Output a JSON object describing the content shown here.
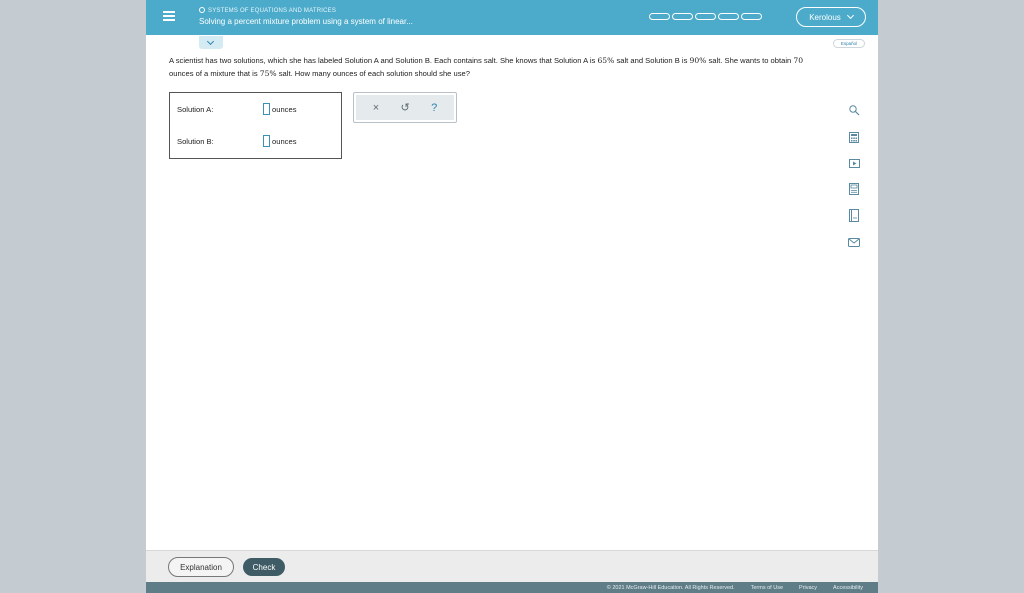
{
  "header": {
    "topic": "SYSTEMS OF EQUATIONS AND MATRICES",
    "lesson_title": "Solving a percent mixture problem using a system of linear...",
    "progress_segments": 5,
    "user_name": "Kerolous"
  },
  "language_toggle": "Español",
  "question": {
    "part1": "A scientist has two solutions, which she has labeled Solution A and Solution B. Each contains salt. She knows that Solution A is ",
    "pct_a": "65%",
    "part2": " salt and Solution B is ",
    "pct_b": "90%",
    "part3": " salt. She wants to obtain ",
    "ounces": "70",
    "part4": " ounces of a mixture that is ",
    "pct_mix": "75%",
    "part5": " salt. How many ounces of each solution should she use?"
  },
  "answers": [
    {
      "label": "Solution A:",
      "unit": "ounces",
      "value": ""
    },
    {
      "label": "Solution B:",
      "unit": "ounces",
      "value": ""
    }
  ],
  "tools": {
    "clear": "×",
    "undo": "↺",
    "help": "?"
  },
  "rail_icons": [
    "scale-search-icon",
    "calculator-icon",
    "video-icon",
    "notebook-icon",
    "dictionary-icon",
    "message-icon"
  ],
  "footer": {
    "explanation_label": "Explanation",
    "check_label": "Check",
    "copyright": "© 2021 McGraw-Hill Education. All Rights Reserved.",
    "terms": "Terms of Use",
    "privacy": "Privacy",
    "accessibility": "Accessibility"
  },
  "colors": {
    "header": "#4cabcb",
    "check_button": "#3f5c66",
    "legal_bar": "#5f7d87"
  }
}
